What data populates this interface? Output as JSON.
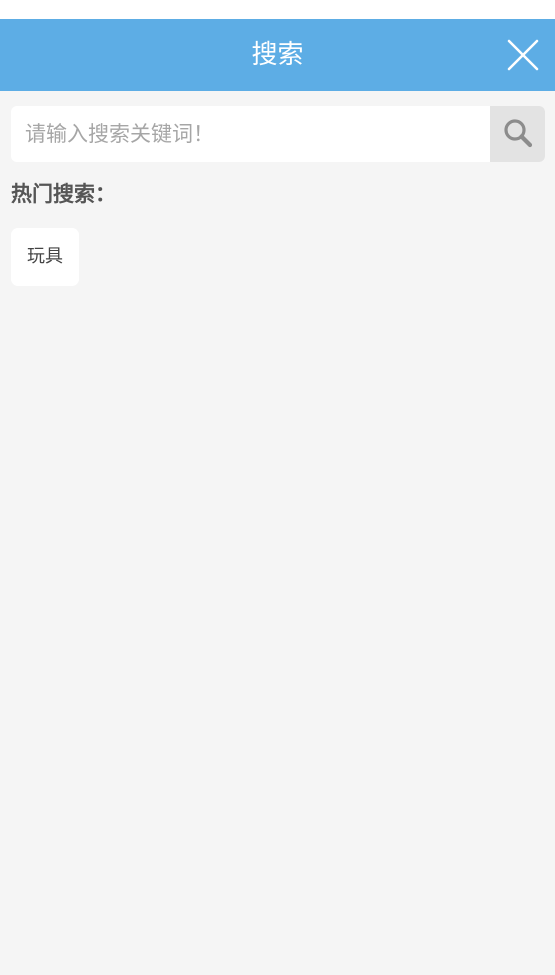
{
  "header": {
    "title": "搜索",
    "close_icon": "close-icon"
  },
  "search": {
    "placeholder": "请输入搜索关键词！",
    "value": "",
    "button_icon": "search-icon"
  },
  "hot_search": {
    "label": "热门搜索：",
    "tags": [
      {
        "label": "玩具"
      }
    ]
  },
  "colors": {
    "header_bg": "#5dade5",
    "page_bg": "#f5f5f5",
    "search_button_bg": "#e3e3e3"
  }
}
